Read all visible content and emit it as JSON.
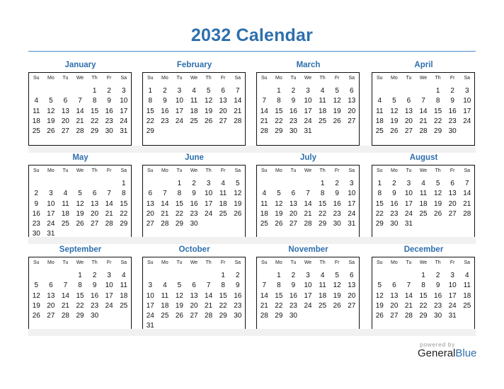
{
  "title": "2032 Calendar",
  "weekday_labels": [
    "Su",
    "Mo",
    "Tu",
    "We",
    "Th",
    "Fr",
    "Sa"
  ],
  "months": [
    {
      "name": "January",
      "start": 4,
      "days": 31
    },
    {
      "name": "February",
      "start": 0,
      "days": 29
    },
    {
      "name": "March",
      "start": 1,
      "days": 31
    },
    {
      "name": "April",
      "start": 4,
      "days": 30
    },
    {
      "name": "May",
      "start": 6,
      "days": 31
    },
    {
      "name": "June",
      "start": 2,
      "days": 30
    },
    {
      "name": "July",
      "start": 4,
      "days": 31
    },
    {
      "name": "August",
      "start": 0,
      "days": 31
    },
    {
      "name": "September",
      "start": 3,
      "days": 30
    },
    {
      "name": "October",
      "start": 5,
      "days": 31
    },
    {
      "name": "November",
      "start": 1,
      "days": 30
    },
    {
      "name": "December",
      "start": 3,
      "days": 31
    }
  ],
  "branding": {
    "powered_by": "powered by",
    "name_part1": "General",
    "name_part2": "Blue"
  },
  "colors": {
    "accent": "#2e6fad",
    "rule": "#4a8ccb",
    "band": "#f1f1f1"
  }
}
